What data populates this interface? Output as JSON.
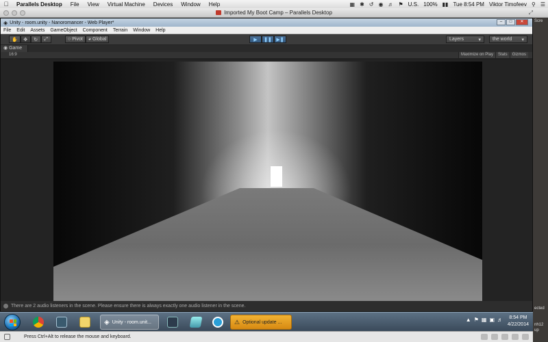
{
  "mac_menubar": {
    "app_name": "Parallels Desktop",
    "items": [
      "File",
      "View",
      "Virtual Machine",
      "Devices",
      "Window",
      "Help"
    ],
    "battery": "100%",
    "input_source": "U.S.",
    "clock": "Tue 8:54 PM",
    "user": "Viktor Timofeev"
  },
  "parallels_window": {
    "title": "Imported My Boot Camp – Parallels Desktop"
  },
  "mac_desktop": {
    "labels": [
      "Scre",
      "ected",
      "nh12",
      "up"
    ]
  },
  "unity": {
    "title": "Unity - room.unity - Nanoromancer - Web Player*",
    "menu": [
      "File",
      "Edit",
      "Assets",
      "GameObject",
      "Component",
      "Terrain",
      "Window",
      "Help"
    ],
    "toolbar": {
      "pivot": "Pivot",
      "global": "Global",
      "layers": "Layers",
      "layout": "the world"
    },
    "game_tab": "Game",
    "aspect": "16:9",
    "game_options": [
      "Maximize on Play",
      "Stats",
      "Gizmos"
    ],
    "console_message": "There are 2 audio listeners in the scene. Please ensure there is always exactly one audio listener in the scene."
  },
  "taskbar": {
    "unity_task": "Unity - room.unit...",
    "update_task": "Optional update ...",
    "clock_time": "8:54 PM",
    "clock_date": "4/22/2014"
  },
  "status_bar": {
    "message": "Press Ctrl+Alt to release the mouse and keyboard."
  }
}
